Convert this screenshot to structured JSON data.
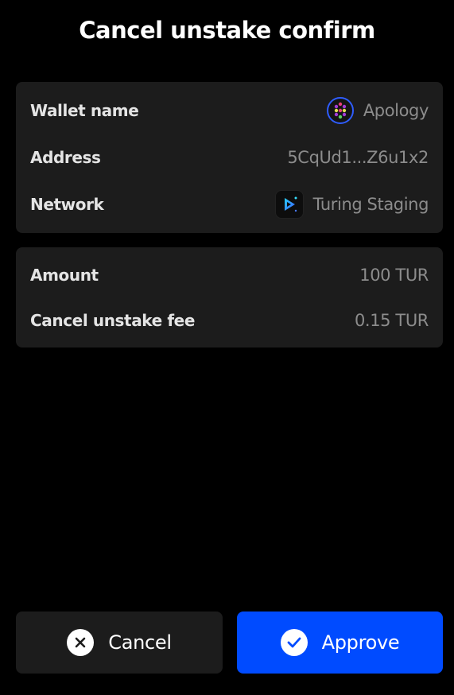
{
  "header": {
    "title": "Cancel unstake confirm"
  },
  "account_card": {
    "wallet_label": "Wallet name",
    "wallet_name": "Apology",
    "wallet_icon": "identicon-avatar",
    "address_label": "Address",
    "address": "5CqUd1...Z6u1x2",
    "network_label": "Network",
    "network": "Turing Staging",
    "network_icon": "turing-network-logo"
  },
  "amount_card": {
    "amount_label": "Amount",
    "amount": "100 TUR",
    "fee_label": "Cancel unstake fee",
    "fee": "0.15 TUR"
  },
  "actions": {
    "cancel_label": "Cancel",
    "cancel_icon": "close-circle-icon",
    "approve_label": "Approve",
    "approve_icon": "check-circle-icon"
  },
  "colors": {
    "background": "#000000",
    "card": "#1c1c1c",
    "primary": "#004bff",
    "muted_text": "#8c8c8c"
  }
}
